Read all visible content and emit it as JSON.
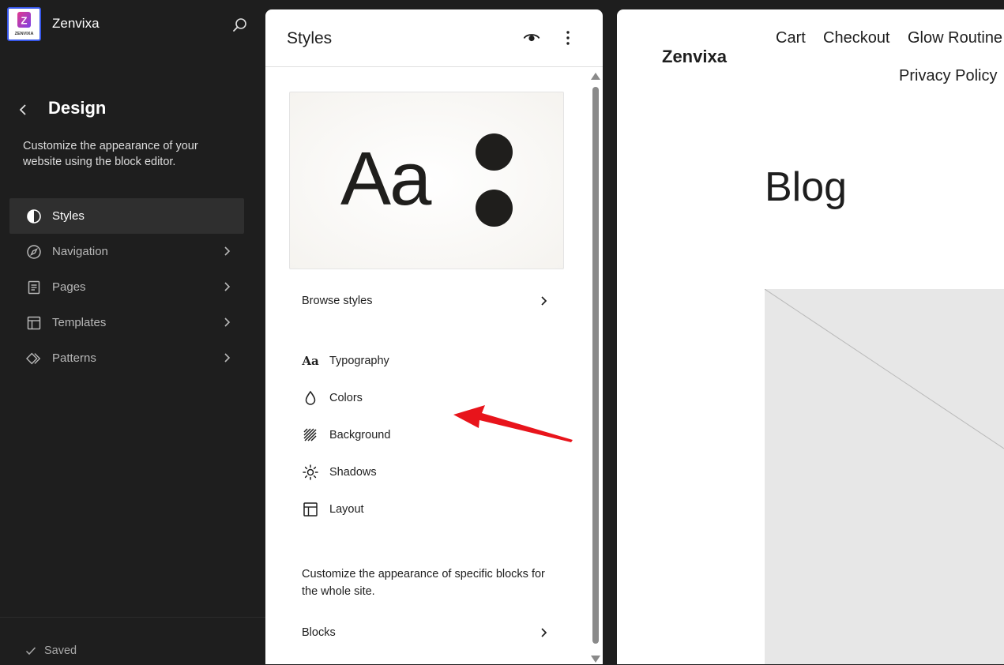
{
  "sidebar": {
    "site_name": "Zenvixa",
    "logo_letter": "Z",
    "logo_text": "ZENVIXA",
    "title": "Design",
    "description": "Customize the appearance of your website using the block editor.",
    "nav_items": [
      {
        "label": "Styles",
        "icon": "half-circle-icon",
        "active": true
      },
      {
        "label": "Navigation",
        "icon": "compass-icon",
        "active": false
      },
      {
        "label": "Pages",
        "icon": "page-icon",
        "active": false
      },
      {
        "label": "Templates",
        "icon": "layout-icon",
        "active": false
      },
      {
        "label": "Patterns",
        "icon": "diamond-icon",
        "active": false
      }
    ],
    "footer_status": "Saved"
  },
  "panel": {
    "title": "Styles",
    "preview_text": "Aa",
    "browse_label": "Browse styles",
    "menu": [
      {
        "label": "Typography",
        "icon": "typography-icon"
      },
      {
        "label": "Colors",
        "icon": "droplet-icon"
      },
      {
        "label": "Background",
        "icon": "background-icon"
      },
      {
        "label": "Shadows",
        "icon": "sun-icon"
      },
      {
        "label": "Layout",
        "icon": "layout-icon"
      }
    ],
    "blocks_description": "Customize the appearance of specific blocks for the whole site.",
    "blocks_label": "Blocks"
  },
  "canvas": {
    "site_title": "Zenvixa",
    "nav": [
      "Cart",
      "Checkout",
      "Glow Routine",
      "Privacy Policy"
    ],
    "page_title": "Blog"
  },
  "colors": {
    "sidebar_bg": "#1e1e1e",
    "accent": "#3858e9",
    "annotation_arrow": "#e8141b"
  }
}
